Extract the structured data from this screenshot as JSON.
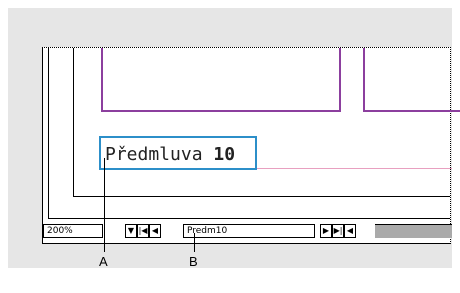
{
  "document": {
    "text_prefix": "Předmluva ",
    "text_number": "10"
  },
  "statusbar": {
    "zoom": "200%",
    "page_field": "Predm10",
    "zoom_menu_icon": "triangle-down",
    "first_page_icon": "first-page",
    "prev_page_icon": "prev-page",
    "next_page_icon": "next-page",
    "last_page_icon": "last-page",
    "scroll_left_icon": "scroll-left"
  },
  "callouts": {
    "a": "A",
    "b": "B"
  },
  "colors": {
    "background": "#e6e6e6",
    "frame_purple": "#8c3f9e",
    "margin_pink": "#e8a0c0",
    "selection_blue": "#2c8fc9"
  }
}
